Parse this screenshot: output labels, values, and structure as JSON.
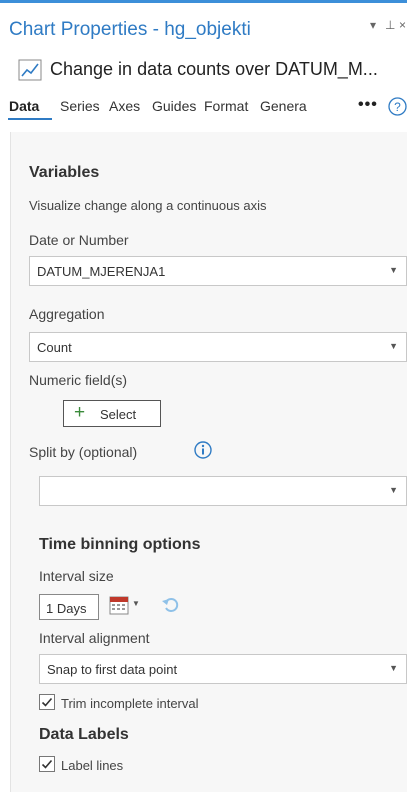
{
  "panel": {
    "title": "Chart Properties - hg_objekti",
    "controls": {
      "dropdown": "▾",
      "pin": "⊥",
      "close": "×"
    },
    "chart_name": "Change in data counts over DATUM_M...",
    "chart_icon": "line-chart-icon"
  },
  "tabs": {
    "items": [
      "Data",
      "Series",
      "Axes",
      "Guides",
      "Format",
      "Genera"
    ],
    "active": "Data",
    "more": "•••",
    "help": "?"
  },
  "variables": {
    "title": "Variables",
    "description": "Visualize change along a continuous axis",
    "date_label": "Date or Number",
    "date_value": "DATUM_MJERENJA1",
    "aggregation_label": "Aggregation",
    "aggregation_value": "Count",
    "numeric_label": "Numeric field(s)",
    "select_label": "Select",
    "split_label": "Split by (optional)",
    "split_value": ""
  },
  "time_binning": {
    "title": "Time binning options",
    "interval_size_label": "Interval size",
    "interval_size_value": "1 Days",
    "interval_alignment_label": "Interval alignment",
    "interval_alignment_value": "Snap to first data point",
    "trim_label": "Trim incomplete interval",
    "trim_checked": true
  },
  "data_labels": {
    "title": "Data Labels",
    "label_lines_label": "Label lines",
    "label_lines_checked": true
  },
  "colors": {
    "accent": "#2f7bc4",
    "panel_bg": "#f7f7f7",
    "plus_green": "#3a8a3a",
    "calendar_red": "#c0392b"
  }
}
